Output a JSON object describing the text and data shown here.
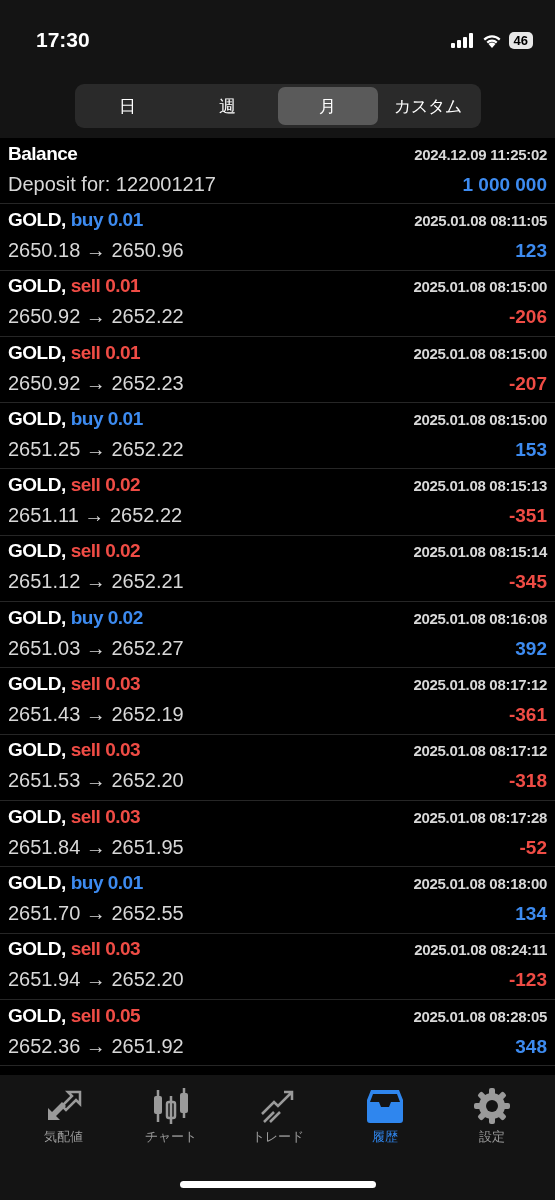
{
  "status_bar": {
    "time": "17:30",
    "battery": "46"
  },
  "periods": [
    {
      "label": "日",
      "selected": false
    },
    {
      "label": "週",
      "selected": false
    },
    {
      "label": "月",
      "selected": true
    },
    {
      "label": "カスタム",
      "selected": false
    }
  ],
  "balance": {
    "title": "Balance",
    "time": "2024.12.09 11:25:02",
    "comment": "Deposit for: 122001217",
    "amount": "1 000 000"
  },
  "deals": [
    {
      "symbol": "GOLD,",
      "deal": "buy 0.01",
      "kind": "buy",
      "time": "2025.01.08 08:11:05",
      "prices": "2650.18 → 2650.96",
      "profit": "123",
      "loss": false
    },
    {
      "symbol": "GOLD,",
      "deal": "sell 0.01",
      "kind": "sell",
      "time": "2025.01.08 08:15:00",
      "prices": "2650.92 → 2652.22",
      "profit": "-206",
      "loss": true
    },
    {
      "symbol": "GOLD,",
      "deal": "sell 0.01",
      "kind": "sell",
      "time": "2025.01.08 08:15:00",
      "prices": "2650.92 → 2652.23",
      "profit": "-207",
      "loss": true
    },
    {
      "symbol": "GOLD,",
      "deal": "buy 0.01",
      "kind": "buy",
      "time": "2025.01.08 08:15:00",
      "prices": "2651.25 → 2652.22",
      "profit": "153",
      "loss": false
    },
    {
      "symbol": "GOLD,",
      "deal": "sell 0.02",
      "kind": "sell",
      "time": "2025.01.08 08:15:13",
      "prices": "2651.11 → 2652.22",
      "profit": "-351",
      "loss": true
    },
    {
      "symbol": "GOLD,",
      "deal": "sell 0.02",
      "kind": "sell",
      "time": "2025.01.08 08:15:14",
      "prices": "2651.12 → 2652.21",
      "profit": "-345",
      "loss": true
    },
    {
      "symbol": "GOLD,",
      "deal": "buy 0.02",
      "kind": "buy",
      "time": "2025.01.08 08:16:08",
      "prices": "2651.03 → 2652.27",
      "profit": "392",
      "loss": false
    },
    {
      "symbol": "GOLD,",
      "deal": "sell 0.03",
      "kind": "sell",
      "time": "2025.01.08 08:17:12",
      "prices": "2651.43 → 2652.19",
      "profit": "-361",
      "loss": true
    },
    {
      "symbol": "GOLD,",
      "deal": "sell 0.03",
      "kind": "sell",
      "time": "2025.01.08 08:17:12",
      "prices": "2651.53 → 2652.20",
      "profit": "-318",
      "loss": true
    },
    {
      "symbol": "GOLD,",
      "deal": "sell 0.03",
      "kind": "sell",
      "time": "2025.01.08 08:17:28",
      "prices": "2651.84 → 2651.95",
      "profit": "-52",
      "loss": true
    },
    {
      "symbol": "GOLD,",
      "deal": "buy 0.01",
      "kind": "buy",
      "time": "2025.01.08 08:18:00",
      "prices": "2651.70 → 2652.55",
      "profit": "134",
      "loss": false
    },
    {
      "symbol": "GOLD,",
      "deal": "sell 0.03",
      "kind": "sell",
      "time": "2025.01.08 08:24:11",
      "prices": "2651.94 → 2652.20",
      "profit": "-123",
      "loss": true
    },
    {
      "symbol": "GOLD,",
      "deal": "sell 0.05",
      "kind": "sell",
      "time": "2025.01.08 08:28:05",
      "prices": "2652.36 → 2651.92",
      "profit": "348",
      "loss": false
    }
  ],
  "tab_bar": [
    {
      "label": "気配値",
      "kind": "quotes",
      "selected": false
    },
    {
      "label": "チャート",
      "kind": "chart",
      "selected": false
    },
    {
      "label": "トレード",
      "kind": "trade",
      "selected": false
    },
    {
      "label": "履歴",
      "kind": "history",
      "selected": true
    },
    {
      "label": "設定",
      "kind": "settings",
      "selected": false
    }
  ]
}
